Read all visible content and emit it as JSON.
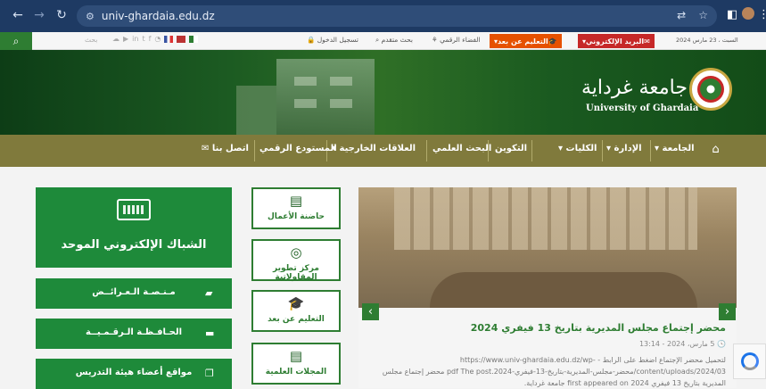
{
  "browser": {
    "url": "univ-ghardaia.edu.dz",
    "back_icon": "arrow-left-icon",
    "forward_icon": "arrow-right-icon",
    "reload_icon": "reload-icon"
  },
  "topbar": {
    "date": "السبت ، 23 مارس 2024",
    "email": "البريد الإلكتروني",
    "distance_learning": "التعليم عن بعد",
    "digital_space": "الفضاء الرقمي",
    "advanced_search": "بحث متقدم",
    "login": "تسجيل الدخول",
    "search_placeholder": "بحث",
    "email_color": "#c62828",
    "distance_color": "#e65100"
  },
  "banner": {
    "name_ar": "جامعة غرداية",
    "name_en": "University of Ghardaia"
  },
  "menu": {
    "items": [
      "الجامعة",
      "الإدارة",
      "الكليات",
      "التكوين",
      "البحث العلمي",
      "العلاقات الخارجية",
      "المستودع الرقمي",
      "اتصل بنا"
    ]
  },
  "slider": {
    "title": "محضر إجتماع مجلس المديرية بتاريخ 13 فيفري 2024",
    "date": "5 مارس، 2024 - 13:14",
    "body": "لتحميل محضر الإجتماع اضغط على الرابط - https://www.univ-ghardaia.edu.dz/wp-content/uploads/2024/03/محضر-مجلس-المديرية-بتاريخ-13-فيفري-2024.pdf The post محضر إجتماع مجلس المديرية بتاريخ 13 فيفري 2024 first appeared on جامعة غرداية."
  },
  "quick_links": [
    {
      "label": "حاضنة الأعمال",
      "icon": "building-icon",
      "glyph": "▤"
    },
    {
      "label": "مركز تطوير المقاولاتية",
      "icon": "target-icon",
      "glyph": "◎"
    },
    {
      "label": "التعليم عن بعد",
      "icon": "graduation-cap-icon",
      "glyph": "🎓"
    },
    {
      "label": "المجلات العلمية",
      "icon": "book-icon",
      "glyph": "▤"
    }
  ],
  "entrance": {
    "label": "الشباك الإلكتروني الموحد",
    "icon": "keyboard-icon"
  },
  "green_buttons": [
    {
      "label": "مـنـصـة الـعـرائــض",
      "icon": "chat-icon",
      "glyph": "▰"
    },
    {
      "label": "الحـافـظـة الـرقـمـيــة",
      "icon": "folder-icon",
      "glyph": "▬"
    },
    {
      "label": "مواقع أعضاء هيئة التدريس",
      "icon": "copy-icon",
      "glyph": "❐"
    }
  ]
}
